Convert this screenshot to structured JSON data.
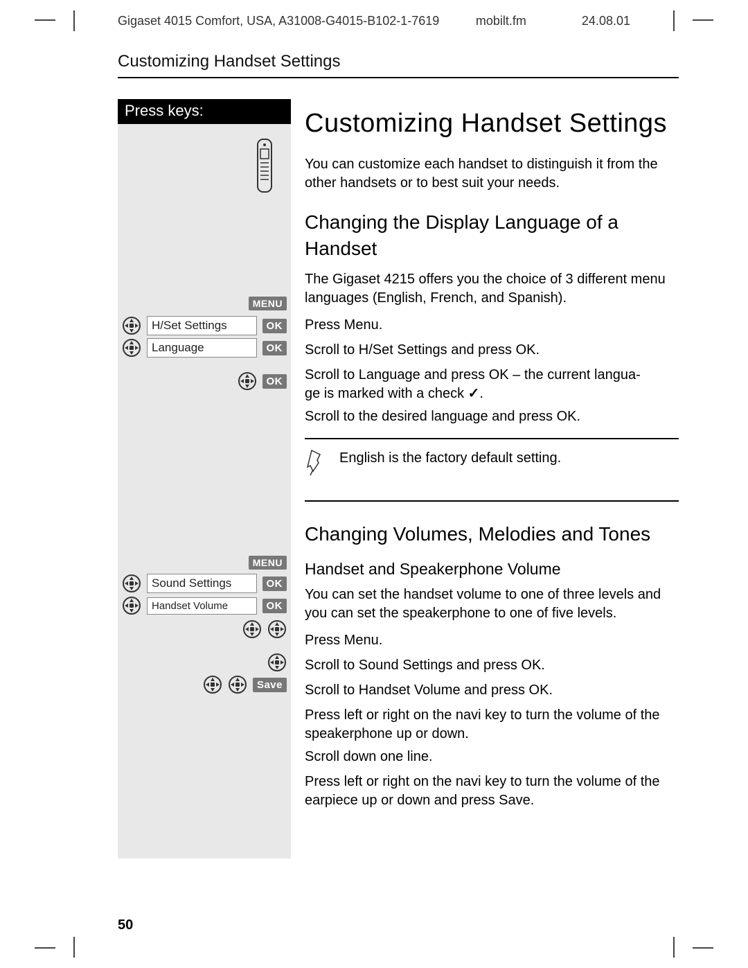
{
  "header": {
    "left": "Gigaset 4015 Comfort, USA, A31008-G4015-B102-1-7619",
    "center": "mobilt.fm",
    "right": "24.08.01"
  },
  "running_title": "Customizing Handset Settings",
  "left_col": {
    "press_keys": "Press keys:",
    "chips": {
      "menu": "MENU",
      "ok": "OK",
      "save": "Save"
    },
    "labels": {
      "hset_settings": "H/Set Settings",
      "language": "Language",
      "sound_settings": "Sound Settings",
      "handset_volume": "Handset Volume"
    }
  },
  "main": {
    "title": "Customizing Handset Settings",
    "intro": "You can customize each handset to distinguish it from the other handsets or to best suit your needs.",
    "section1": {
      "heading": "Changing the Display Language of a Handset",
      "para": "The Gigaset 4215 offers you the choice of 3 different menu languages (English, French, and Spanish).",
      "step1": "Press Menu.",
      "step2": "Scroll to H/Set Settings and press OK.",
      "step3_a": "Scroll to Language and press OK – the current langua-",
      "step3_b": "ge is marked with a check ",
      "step3_c": ".",
      "step4": "Scroll to the desired language and press OK.",
      "note": "English is the factory default setting."
    },
    "section2": {
      "heading": "Changing Volumes, Melodies and Tones",
      "sub": "Handset and Speakerphone Volume",
      "para": "You can set the handset volume to one of three levels and you can set the speakerphone to one of five levels.",
      "step1": "Press Menu.",
      "step2": "Scroll to Sound Settings and press OK.",
      "step3": "Scroll to Handset Volume and press OK.",
      "step4": "Press left or right on the navi key to turn the volume of the speakerphone up or down.",
      "step5": "Scroll down one line.",
      "step6": "Press left or right on the navi key to turn the volume of the earpiece up or down and press Save."
    }
  },
  "page_number": "50"
}
